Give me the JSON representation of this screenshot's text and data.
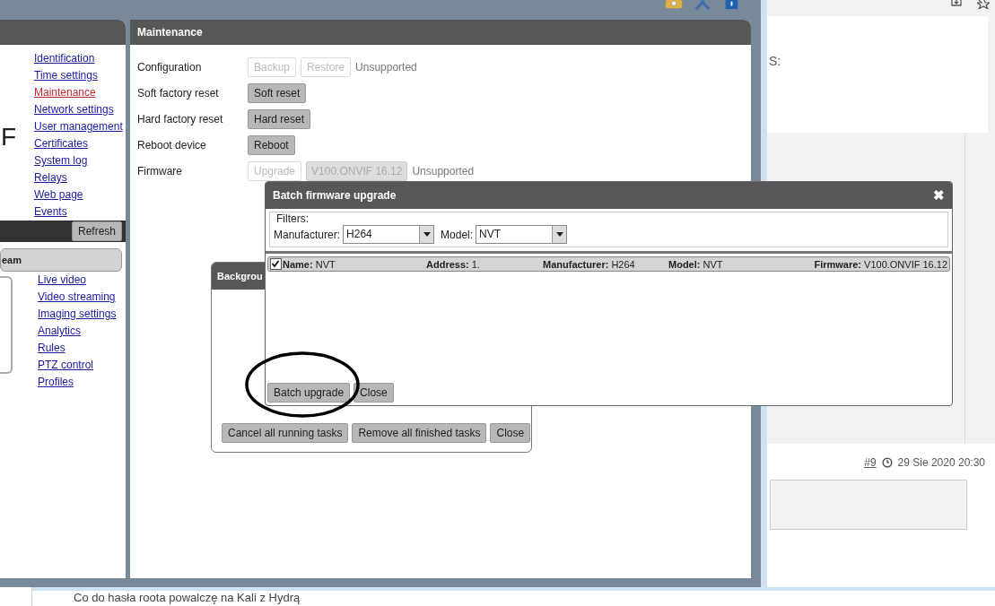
{
  "left_panel": {
    "logo_text": "F",
    "nav_links": [
      {
        "label": "Identification",
        "selected": false
      },
      {
        "label": "Time settings",
        "selected": false
      },
      {
        "label": "Maintenance",
        "selected": true
      },
      {
        "label": "Network settings",
        "selected": false
      },
      {
        "label": "User management",
        "selected": false
      },
      {
        "label": "Certificates",
        "selected": false
      },
      {
        "label": "System log",
        "selected": false
      },
      {
        "label": "Relays",
        "selected": false
      },
      {
        "label": "Web page",
        "selected": false
      },
      {
        "label": "Events",
        "selected": false
      }
    ],
    "refresh_button": "Refresh",
    "stream_tab": "eam",
    "stream_links": [
      {
        "label": "Live video",
        "selected": false
      },
      {
        "label": "Video streaming",
        "selected": false
      },
      {
        "label": "Imaging settings",
        "selected": false
      },
      {
        "label": "Analytics",
        "selected": false
      },
      {
        "label": "Rules",
        "selected": false
      },
      {
        "label": "PTZ control",
        "selected": false
      },
      {
        "label": "Profiles",
        "selected": false
      }
    ]
  },
  "maintenance": {
    "title": "Maintenance",
    "rows": [
      {
        "label": "Configuration",
        "buttons": [
          {
            "label": "Backup",
            "kind": "button",
            "disabled": true
          },
          {
            "label": "Restore",
            "kind": "button",
            "disabled": true
          }
        ],
        "status": "Unsupported"
      },
      {
        "label": "Soft factory reset",
        "buttons": [
          {
            "label": "Soft reset",
            "kind": "button",
            "disabled": false
          }
        ]
      },
      {
        "label": "Hard factory reset",
        "buttons": [
          {
            "label": "Hard reset",
            "kind": "button",
            "disabled": false
          }
        ]
      },
      {
        "label": "Reboot device",
        "buttons": [
          {
            "label": "Reboot",
            "kind": "button",
            "disabled": false
          }
        ]
      },
      {
        "label": "Firmware",
        "buttons": [
          {
            "label": "Upgrade",
            "kind": "button",
            "disabled": true
          },
          {
            "label": "V100.ONVIF 16.12",
            "kind": "version",
            "disabled": true
          }
        ],
        "status": "Unsupported"
      }
    ]
  },
  "background_tasks": {
    "title": "Backgrou",
    "buttons": [
      "Cancel all running tasks",
      "Remove all finished tasks",
      "Close"
    ]
  },
  "batch_dialog": {
    "title": "Batch firmware upgrade",
    "close": "✖",
    "filters_legend": "Filters:",
    "manufacturer": {
      "label": "Manufacturer:",
      "value": "H264"
    },
    "model": {
      "label": "Model:",
      "value": "NVT"
    },
    "devices": [
      {
        "checked": true,
        "fields": [
          {
            "label": "Name:",
            "value": "NVT"
          },
          {
            "label": "Address:",
            "value": "1."
          },
          {
            "label": "Manufacturer:",
            "value": "H264"
          },
          {
            "label": "Model:",
            "value": "NVT"
          },
          {
            "label": "Firmware:",
            "value": "V100.ONVIF 16.12"
          }
        ]
      }
    ],
    "buttons": [
      "Batch upgrade",
      "Close"
    ]
  },
  "browser": {
    "fragment": "S:",
    "post_link": "#9",
    "post_date": "29 Sie 2020 20:30",
    "post_text": "Co do hasła roota powalczę na Kali z Hydrą"
  }
}
